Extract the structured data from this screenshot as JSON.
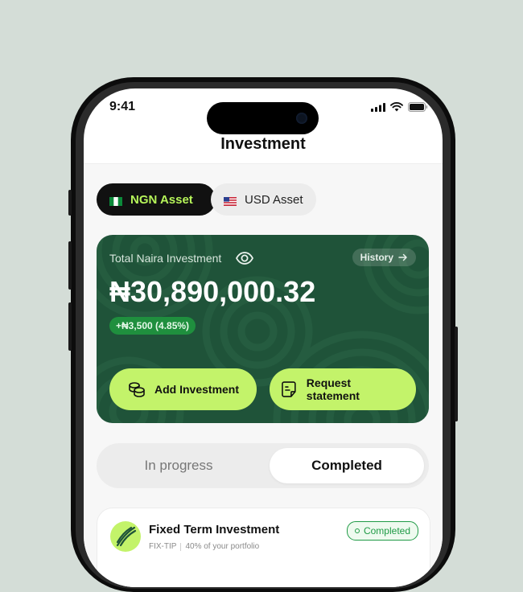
{
  "status_bar": {
    "time": "9:41"
  },
  "header": {
    "title": "Investment"
  },
  "asset_tabs": [
    {
      "label": "NGN Asset",
      "flag": "nigeria-flag",
      "active": true
    },
    {
      "label": "USD Asset",
      "flag": "us-flag",
      "active": false
    }
  ],
  "balance_card": {
    "label": "Total Naira Investment",
    "history_label": "History",
    "balance": "₦30,890,000.32",
    "change": "+₦3,500 (4.85%)",
    "add_label": "Add Investment",
    "statement_label": "Request statement"
  },
  "segments": {
    "left": "In progress",
    "right": "Completed",
    "selected": "Completed"
  },
  "investment": {
    "title": "Fixed Term Investment",
    "code": "FIX-TIP",
    "portfolio": "40% of your portfolio",
    "status": "Completed"
  },
  "colors": {
    "accent": "#c3f36a",
    "card_green": "#1f5339",
    "success": "#1f9a45",
    "background": "#d4ddd7"
  }
}
